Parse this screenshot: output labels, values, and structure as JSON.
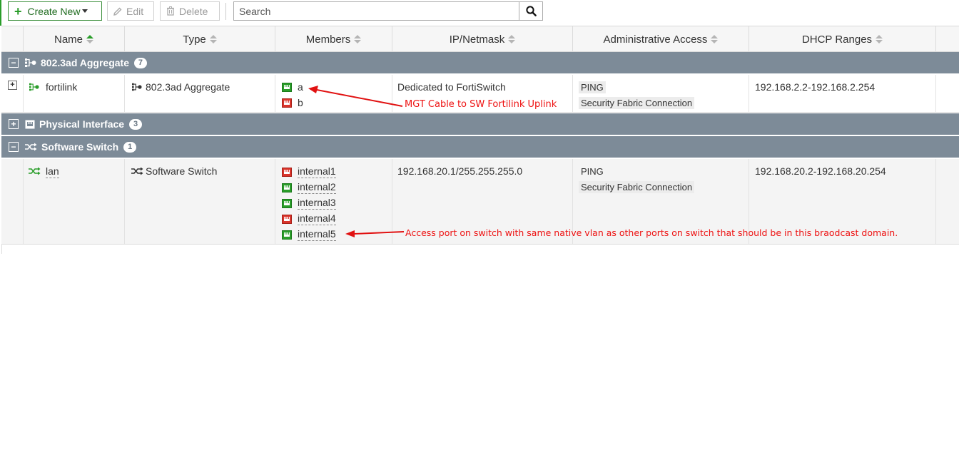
{
  "toolbar": {
    "create_label": "Create New",
    "edit_label": "Edit",
    "delete_label": "Delete",
    "search_placeholder": "Search"
  },
  "columns": [
    "Name",
    "Type",
    "Members",
    "IP/Netmask",
    "Administrative Access",
    "DHCP Ranges"
  ],
  "groups": [
    {
      "label": "802.3ad Aggregate",
      "count": "7",
      "expanded": true,
      "rows": [
        {
          "name": "fortilink",
          "type": "802.3ad Aggregate",
          "members": [
            {
              "label": "a",
              "status": "up"
            },
            {
              "label": "b",
              "status": "down"
            }
          ],
          "ip": "Dedicated to FortiSwitch",
          "access": [
            "PING",
            "Security Fabric Connection"
          ],
          "dhcp": "192.168.2.2-192.168.2.254"
        }
      ]
    },
    {
      "label": "Physical Interface",
      "count": "3",
      "expanded": false,
      "rows": []
    },
    {
      "label": "Software Switch",
      "count": "1",
      "expanded": true,
      "rows": [
        {
          "name": "lan",
          "type": "Software Switch",
          "members": [
            {
              "label": "internal1",
              "status": "down"
            },
            {
              "label": "internal2",
              "status": "up"
            },
            {
              "label": "internal3",
              "status": "up"
            },
            {
              "label": "internal4",
              "status": "down"
            },
            {
              "label": "internal5",
              "status": "up"
            }
          ],
          "ip": "192.168.20.1/255.255.255.0",
          "access": [
            "PING",
            "Security Fabric Connection"
          ],
          "dhcp": "192.168.20.2-192.168.20.254"
        }
      ]
    }
  ],
  "annotations": {
    "fortilink_note": "MGT Cable to SW Fortilink Uplink",
    "lan_note": "Access port on switch with same native vlan as other ports on switch that should be in this braodcast domain."
  },
  "colors": {
    "accent_green": "#2a9d2a",
    "group_header": "#7d8b98",
    "port_up": "#2a9d2a",
    "port_down": "#d9342b",
    "annotation_red": "#e11111"
  },
  "icons": {
    "create": "plus-icon",
    "edit": "pencil-icon",
    "delete": "trash-icon",
    "search": "magnifier-icon",
    "aggregate": "aggregate-icon",
    "physical": "physical-port-icon",
    "switch": "software-switch-icon",
    "port": "ethernet-port-icon"
  }
}
